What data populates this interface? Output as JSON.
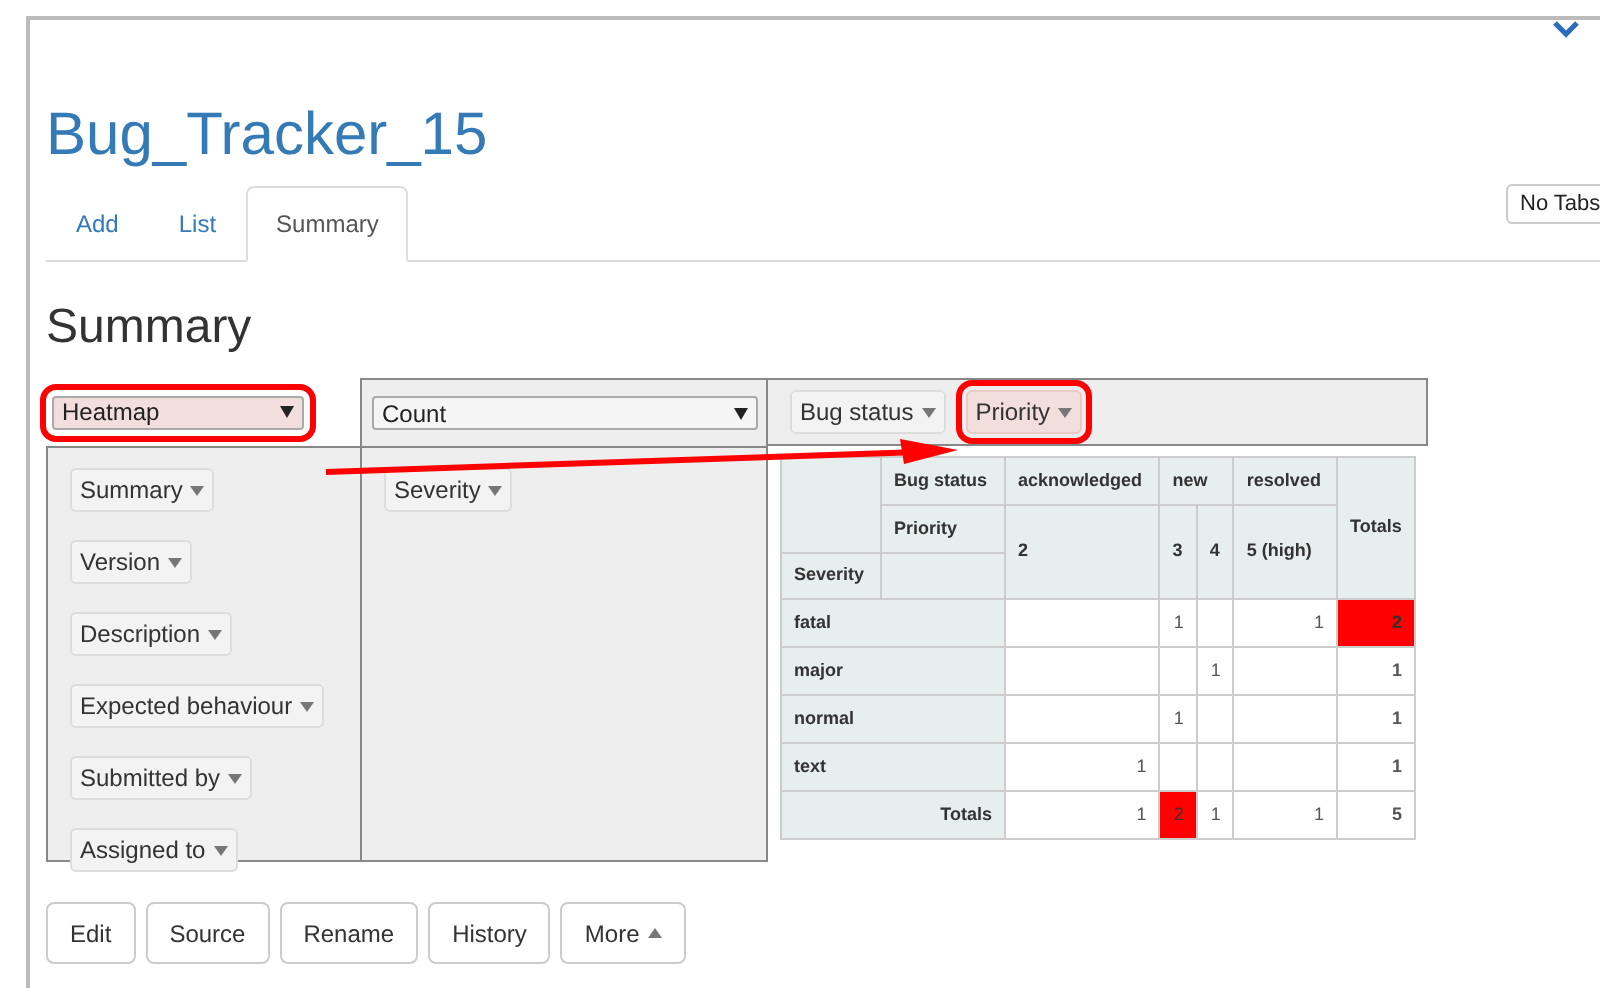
{
  "title": "Bug_Tracker_15",
  "tabs": [
    {
      "label": "Add",
      "selected": false
    },
    {
      "label": "List",
      "selected": false
    },
    {
      "label": "Summary",
      "selected": true
    }
  ],
  "no_tabs_button": "No Tabs",
  "heading": "Summary",
  "renderer": {
    "value": "Heatmap",
    "highlighted": true
  },
  "aggregator": {
    "value": "Count",
    "highlighted": false
  },
  "col_attrs": [
    {
      "label": "Bug status",
      "highlighted": false
    },
    {
      "label": "Priority",
      "highlighted": true
    }
  ],
  "unused_attrs": [
    {
      "label": "Summary"
    },
    {
      "label": "Version"
    },
    {
      "label": "Description"
    },
    {
      "label": "Expected behaviour"
    },
    {
      "label": "Submitted by"
    },
    {
      "label": "Assigned to"
    }
  ],
  "row_attrs": [
    {
      "label": "Severity"
    }
  ],
  "pivot": {
    "col_attr_1": "Bug status",
    "col_attr_2": "Priority",
    "row_attr": "Severity",
    "totals_header": "Totals",
    "col_groups": [
      {
        "label": "acknowledged",
        "children": [
          {
            "label": "2"
          }
        ]
      },
      {
        "label": "new",
        "children": [
          {
            "label": "3"
          },
          {
            "label": "4"
          }
        ]
      },
      {
        "label": "resolved",
        "children": [
          {
            "label": "5 (high)"
          }
        ]
      }
    ],
    "rows": [
      {
        "label": "fatal",
        "cells": [
          null,
          {
            "text": "1",
            "hot": false
          },
          null,
          {
            "text": "1",
            "hot": false
          }
        ],
        "total": {
          "text": "2",
          "hot": true
        }
      },
      {
        "label": "major",
        "cells": [
          null,
          null,
          {
            "text": "1",
            "hot": false
          },
          null
        ],
        "total": {
          "text": "1",
          "hot": false
        }
      },
      {
        "label": "normal",
        "cells": [
          null,
          {
            "text": "1",
            "hot": false
          },
          null,
          null
        ],
        "total": {
          "text": "1",
          "hot": false
        }
      },
      {
        "label": "text",
        "cells": [
          {
            "text": "1",
            "hot": false
          },
          null,
          null,
          null
        ],
        "total": {
          "text": "1",
          "hot": false
        }
      }
    ],
    "totals_row": {
      "label": "Totals",
      "cells": [
        {
          "text": "1",
          "hot": false
        },
        {
          "text": "2",
          "hot": true
        },
        {
          "text": "1",
          "hot": false
        },
        {
          "text": "1",
          "hot": false
        }
      ],
      "total": {
        "text": "5",
        "hot": false
      }
    }
  },
  "buttons": [
    {
      "label": "Edit",
      "kind": "plain"
    },
    {
      "label": "Source",
      "kind": "plain"
    },
    {
      "label": "Rename",
      "kind": "plain"
    },
    {
      "label": "History",
      "kind": "plain"
    },
    {
      "label": "More",
      "kind": "menu"
    }
  ]
}
